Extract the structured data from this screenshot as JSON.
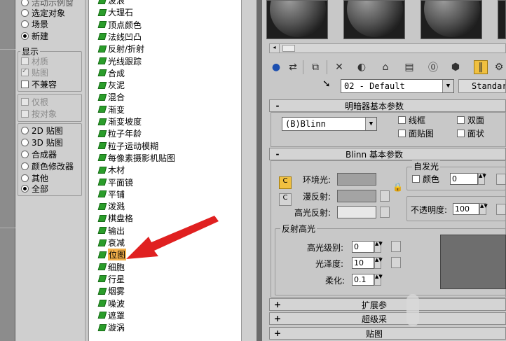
{
  "left_panel": {
    "browse_options": [
      "活动示例窗",
      "选定对象",
      "场景",
      "新建"
    ],
    "browse_selected": 3,
    "display_title": "显示",
    "display_options": [
      {
        "label": "材质",
        "checked": false,
        "disabled": true
      },
      {
        "label": "贴图",
        "checked": true,
        "disabled": true
      },
      {
        "label": "不兼容",
        "checked": false,
        "disabled": false
      }
    ],
    "root_options": [
      {
        "label": "仅根",
        "disabled": true
      },
      {
        "label": "按对象",
        "disabled": true
      }
    ],
    "filter_options": [
      "2D 贴图",
      "3D 贴图",
      "合成器",
      "颜色修改器",
      "其他",
      "全部"
    ],
    "filter_selected": 5
  },
  "map_list": {
    "items": [
      "波浪",
      "大理石",
      "顶点颜色",
      "法线凹凸",
      "反射/折射",
      "光线跟踪",
      "合成",
      "灰泥",
      "混合",
      "渐变",
      "渐变坡度",
      "粒子年龄",
      "粒子运动模糊",
      "每像素摄影机贴图",
      "木材",
      "平面镜",
      "平铺",
      "泼溅",
      "棋盘格",
      "输出",
      "衰减",
      "位图",
      "细胞",
      "行星",
      "烟雾",
      "噪波",
      "遮罩",
      "漩涡"
    ],
    "selected_index": 21
  },
  "material_editor": {
    "material_name": "02 - Default",
    "material_type": "Standard",
    "shader_rollout_title": "明暗器基本参数",
    "shader_type": "(B)Blinn",
    "shader_checks": [
      "线框",
      "面贴图",
      "双面",
      "面状"
    ],
    "blinn_rollout_title": "Blinn 基本参数",
    "self_illum_title": "自发光",
    "color_label": "颜色",
    "self_illum_value": "0",
    "ambient_label": "环境光:",
    "diffuse_label": "漫反射:",
    "specular_label": "高光反射:",
    "opacity_label": "不透明度:",
    "opacity_value": "100",
    "spec_highlight_title": "反射高光",
    "spec_level_label": "高光级别:",
    "spec_level_value": "0",
    "glossiness_label": "光泽度:",
    "glossiness_value": "10",
    "soften_label": "柔化:",
    "soften_value": "0.1",
    "collapsed_rollouts": [
      "扩展参",
      "超级采",
      "贴图"
    ],
    "colors": {
      "ambient": "#a0a0a0",
      "diffuse": "#a4a4a4",
      "specular": "#e8e8e8",
      "arrow": "#e02020"
    }
  }
}
